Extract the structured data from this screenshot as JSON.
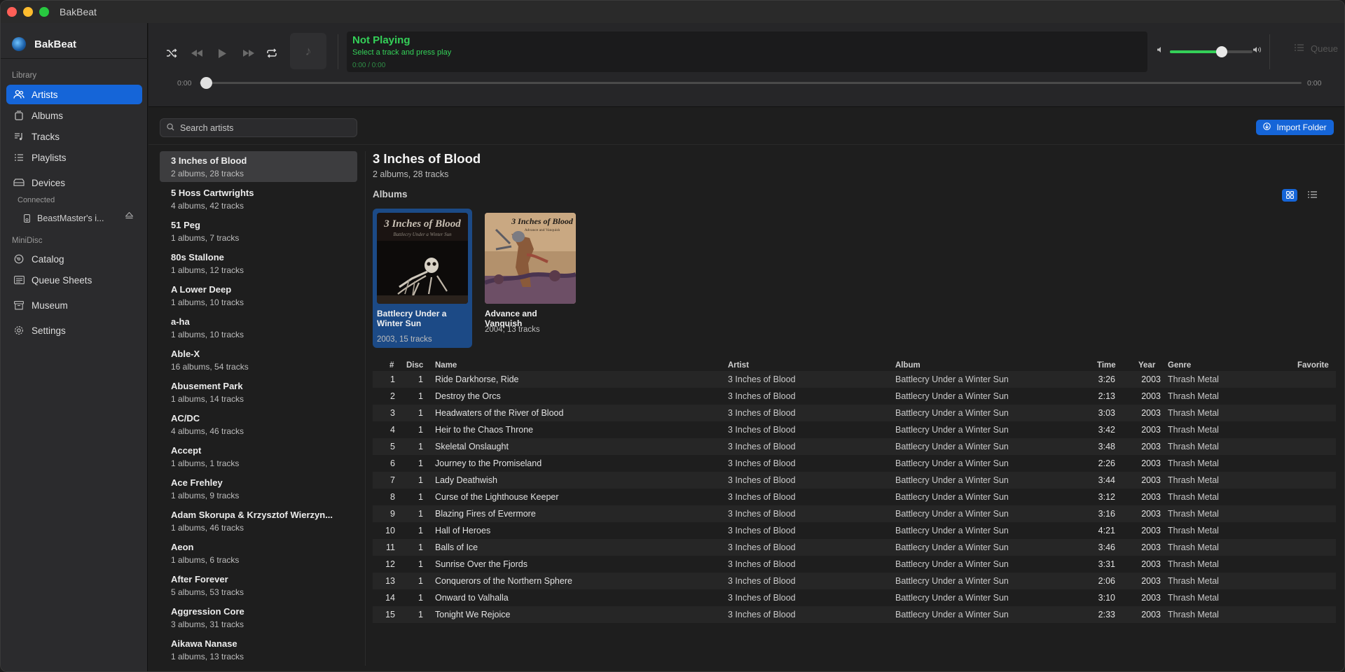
{
  "window": {
    "title": "BakBeat"
  },
  "sidebar": {
    "brand": "BakBeat",
    "library_label": "Library",
    "library_items": [
      {
        "label": "Artists",
        "icon": "people-icon",
        "active": true
      },
      {
        "label": "Albums",
        "icon": "album-icon",
        "active": false
      },
      {
        "label": "Tracks",
        "icon": "music-note-list-icon",
        "active": false
      },
      {
        "label": "Playlists",
        "icon": "playlist-icon",
        "active": false
      }
    ],
    "devices_label": "Devices",
    "connected_label": "Connected",
    "device_name": "BeastMaster's i...",
    "minidisc_label": "MiniDisc",
    "minidisc_items": [
      {
        "label": "Catalog",
        "icon": "catalog-icon"
      },
      {
        "label": "Queue Sheets",
        "icon": "sheet-icon"
      }
    ],
    "museum": "Museum",
    "settings": "Settings"
  },
  "player": {
    "now_playing_title": "Not Playing",
    "now_playing_sub": "Select a track and press play",
    "now_playing_time": "0:00 / 0:00",
    "elapsed": "0:00",
    "remaining": "0:00",
    "volume": 0.63,
    "queue_label": "Queue"
  },
  "search": {
    "placeholder": "Search artists"
  },
  "import_label": "Import Folder",
  "artists": [
    {
      "name": "3 Inches of Blood",
      "meta": "2 albums, 28 tracks",
      "selected": true
    },
    {
      "name": "5 Hoss Cartwrights",
      "meta": "4 albums, 42 tracks"
    },
    {
      "name": "51 Peg",
      "meta": "1 albums, 7 tracks"
    },
    {
      "name": "80s Stallone",
      "meta": "1 albums, 12 tracks"
    },
    {
      "name": "A Lower Deep",
      "meta": "1 albums, 10 tracks"
    },
    {
      "name": "a-ha",
      "meta": "1 albums, 10 tracks"
    },
    {
      "name": "Able-X",
      "meta": "16 albums, 54 tracks"
    },
    {
      "name": "Abusement Park",
      "meta": "1 albums, 14 tracks"
    },
    {
      "name": "AC/DC",
      "meta": "4 albums, 46 tracks"
    },
    {
      "name": "Accept",
      "meta": "1 albums, 1 tracks"
    },
    {
      "name": "Ace Frehley",
      "meta": "1 albums, 9 tracks"
    },
    {
      "name": "Adam Skorupa & Krzysztof Wierzyn...",
      "meta": "1 albums, 46 tracks"
    },
    {
      "name": "Aeon",
      "meta": "1 albums, 6 tracks"
    },
    {
      "name": "After Forever",
      "meta": "5 albums, 53 tracks"
    },
    {
      "name": "Aggression Core",
      "meta": "3 albums, 31 tracks"
    },
    {
      "name": "Aikawa Nanase",
      "meta": "1 albums, 13 tracks"
    }
  ],
  "detail": {
    "title": "3 Inches of Blood",
    "subtitle": "2 albums, 28 tracks",
    "albums_label": "Albums",
    "albums": [
      {
        "name": "Battlecry Under a Winter Sun",
        "meta": "2003, 15 tracks",
        "selected": true,
        "cover_text": "3 Inches of Blood",
        "cover_sub": "Battlecry Under a Winter Sun"
      },
      {
        "name": "Advance and Vanquish",
        "meta": "2004, 13 tracks",
        "selected": false,
        "cover_text": "3 Inches of Blood",
        "cover_sub": "Advance and Vanquish"
      }
    ]
  },
  "table": {
    "headers": {
      "num": "#",
      "disc": "Disc",
      "name": "Name",
      "artist": "Artist",
      "album": "Album",
      "time": "Time",
      "year": "Year",
      "genre": "Genre",
      "favorite": "Favorite"
    },
    "rows": [
      {
        "num": "1",
        "disc": "1",
        "name": "Ride Darkhorse, Ride",
        "artist": "3 Inches of Blood",
        "album": "Battlecry Under a Winter Sun",
        "time": "3:26",
        "year": "2003",
        "genre": "Thrash Metal"
      },
      {
        "num": "2",
        "disc": "1",
        "name": "Destroy the Orcs",
        "artist": "3 Inches of Blood",
        "album": "Battlecry Under a Winter Sun",
        "time": "2:13",
        "year": "2003",
        "genre": "Thrash Metal"
      },
      {
        "num": "3",
        "disc": "1",
        "name": "Headwaters of the River of Blood",
        "artist": "3 Inches of Blood",
        "album": "Battlecry Under a Winter Sun",
        "time": "3:03",
        "year": "2003",
        "genre": "Thrash Metal"
      },
      {
        "num": "4",
        "disc": "1",
        "name": "Heir to the Chaos Throne",
        "artist": "3 Inches of Blood",
        "album": "Battlecry Under a Winter Sun",
        "time": "3:42",
        "year": "2003",
        "genre": "Thrash Metal"
      },
      {
        "num": "5",
        "disc": "1",
        "name": "Skeletal Onslaught",
        "artist": "3 Inches of Blood",
        "album": "Battlecry Under a Winter Sun",
        "time": "3:48",
        "year": "2003",
        "genre": "Thrash Metal"
      },
      {
        "num": "6",
        "disc": "1",
        "name": "Journey to the Promiseland",
        "artist": "3 Inches of Blood",
        "album": "Battlecry Under a Winter Sun",
        "time": "2:26",
        "year": "2003",
        "genre": "Thrash Metal"
      },
      {
        "num": "7",
        "disc": "1",
        "name": "Lady Deathwish",
        "artist": "3 Inches of Blood",
        "album": "Battlecry Under a Winter Sun",
        "time": "3:44",
        "year": "2003",
        "genre": "Thrash Metal"
      },
      {
        "num": "8",
        "disc": "1",
        "name": "Curse of the Lighthouse Keeper",
        "artist": "3 Inches of Blood",
        "album": "Battlecry Under a Winter Sun",
        "time": "3:12",
        "year": "2003",
        "genre": "Thrash Metal"
      },
      {
        "num": "9",
        "disc": "1",
        "name": "Blazing Fires of Evermore",
        "artist": "3 Inches of Blood",
        "album": "Battlecry Under a Winter Sun",
        "time": "3:16",
        "year": "2003",
        "genre": "Thrash Metal"
      },
      {
        "num": "10",
        "disc": "1",
        "name": "Hall of Heroes",
        "artist": "3 Inches of Blood",
        "album": "Battlecry Under a Winter Sun",
        "time": "4:21",
        "year": "2003",
        "genre": "Thrash Metal"
      },
      {
        "num": "11",
        "disc": "1",
        "name": "Balls of Ice",
        "artist": "3 Inches of Blood",
        "album": "Battlecry Under a Winter Sun",
        "time": "3:46",
        "year": "2003",
        "genre": "Thrash Metal"
      },
      {
        "num": "12",
        "disc": "1",
        "name": "Sunrise Over the Fjords",
        "artist": "3 Inches of Blood",
        "album": "Battlecry Under a Winter Sun",
        "time": "3:31",
        "year": "2003",
        "genre": "Thrash Metal"
      },
      {
        "num": "13",
        "disc": "1",
        "name": "Conquerors of the Northern Sphere",
        "artist": "3 Inches of Blood",
        "album": "Battlecry Under a Winter Sun",
        "time": "2:06",
        "year": "2003",
        "genre": "Thrash Metal"
      },
      {
        "num": "14",
        "disc": "1",
        "name": "Onward to Valhalla",
        "artist": "3 Inches of Blood",
        "album": "Battlecry Under a Winter Sun",
        "time": "3:10",
        "year": "2003",
        "genre": "Thrash Metal"
      },
      {
        "num": "15",
        "disc": "1",
        "name": "Tonight We Rejoice",
        "artist": "3 Inches of Blood",
        "album": "Battlecry Under a Winter Sun",
        "time": "2:33",
        "year": "2003",
        "genre": "Thrash Metal"
      }
    ]
  },
  "colors": {
    "accent": "#1565d8",
    "playing_green": "#34d058",
    "background": "#1e1e1e",
    "sidebar": "#2b2b2d"
  }
}
